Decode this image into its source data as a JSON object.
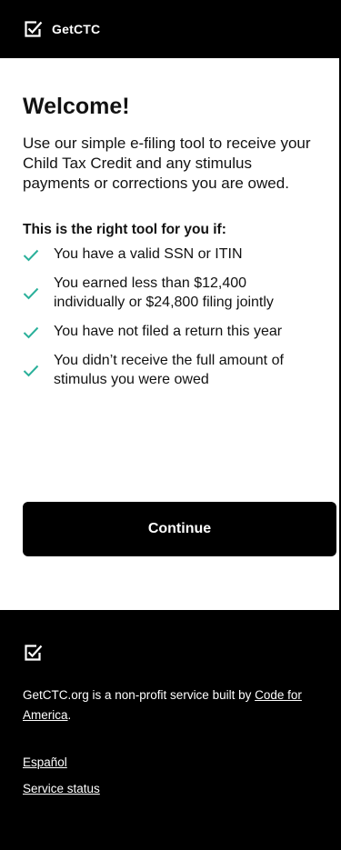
{
  "header": {
    "logo_icon": "checkbox-checked-icon",
    "brand": "GetCTC"
  },
  "main": {
    "title": "Welcome!",
    "intro": "Use our simple e-filing tool to receive your Child Tax Credit and any stimulus payments or corrections you are owed.",
    "subhead": "This is the right tool for you if:",
    "check_icon": "checkmark-icon",
    "check_color": "#2ab09a",
    "criteria": [
      "You have a valid SSN or ITIN",
      "You earned less than $12,400 individually or $24,800 filing jointly",
      "You have not filed a return this year",
      "You didn’t receive the full amount of stimulus you were owed"
    ],
    "continue_label": "Continue"
  },
  "footer": {
    "logo_icon": "checkbox-checked-icon",
    "about_prefix": "GetCTC.org is a non-profit service built by ",
    "about_link": "Code for America",
    "about_suffix": ".",
    "links": [
      "Español",
      "Service status"
    ]
  }
}
